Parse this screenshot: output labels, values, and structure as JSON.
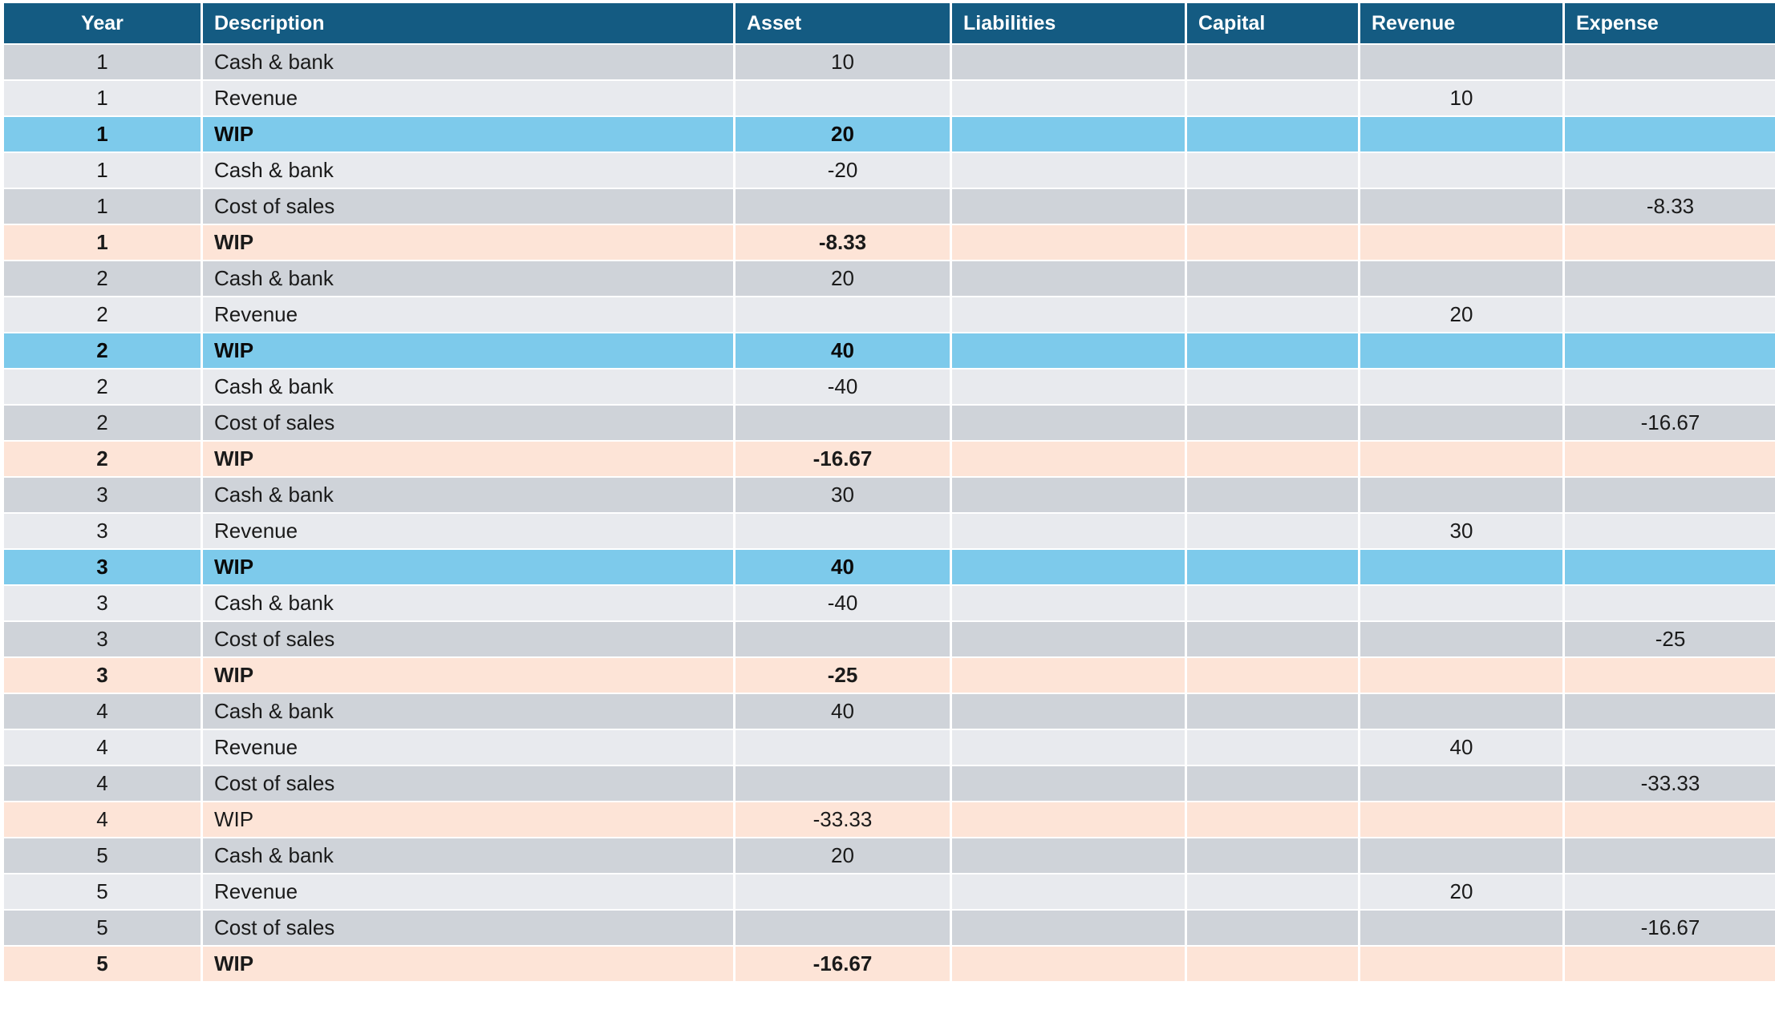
{
  "headers": {
    "year": "Year",
    "description": "Description",
    "asset": "Asset",
    "liabilities": "Liabilities",
    "capital": "Capital",
    "revenue": "Revenue",
    "expense": "Expense"
  },
  "colors": {
    "header": "#145b82",
    "row_dark": "#cfd3d9",
    "row_light": "#e8eaee",
    "row_highlight_blue": "#7dcaeb",
    "row_highlight_peach": "#fde4d7"
  },
  "rows": [
    {
      "style": "row-a",
      "bold": false,
      "year": "1",
      "description": "Cash & bank",
      "asset": "10",
      "liabilities": "",
      "capital": "",
      "revenue": "",
      "expense": ""
    },
    {
      "style": "row-b",
      "bold": false,
      "year": "1",
      "description": "Revenue",
      "asset": "",
      "liabilities": "",
      "capital": "",
      "revenue": "10",
      "expense": ""
    },
    {
      "style": "row-blue",
      "bold": true,
      "year": "1",
      "description": "WIP",
      "asset": "20",
      "liabilities": "",
      "capital": "",
      "revenue": "",
      "expense": ""
    },
    {
      "style": "row-b",
      "bold": false,
      "year": "1",
      "description": "Cash & bank",
      "asset": "-20",
      "liabilities": "",
      "capital": "",
      "revenue": "",
      "expense": ""
    },
    {
      "style": "row-a",
      "bold": false,
      "year": "1",
      "description": "Cost of sales",
      "asset": "",
      "liabilities": "",
      "capital": "",
      "revenue": "",
      "expense": "-8.33"
    },
    {
      "style": "row-peach",
      "bold": true,
      "year": "1",
      "description": "WIP",
      "asset": "-8.33",
      "liabilities": "",
      "capital": "",
      "revenue": "",
      "expense": ""
    },
    {
      "style": "row-a",
      "bold": false,
      "year": "2",
      "description": "Cash & bank",
      "asset": "20",
      "liabilities": "",
      "capital": "",
      "revenue": "",
      "expense": ""
    },
    {
      "style": "row-b",
      "bold": false,
      "year": "2",
      "description": "Revenue",
      "asset": "",
      "liabilities": "",
      "capital": "",
      "revenue": "20",
      "expense": ""
    },
    {
      "style": "row-blue",
      "bold": true,
      "year": "2",
      "description": "WIP",
      "asset": "40",
      "liabilities": "",
      "capital": "",
      "revenue": "",
      "expense": ""
    },
    {
      "style": "row-b",
      "bold": false,
      "year": "2",
      "description": "Cash & bank",
      "asset": "-40",
      "liabilities": "",
      "capital": "",
      "revenue": "",
      "expense": ""
    },
    {
      "style": "row-a",
      "bold": false,
      "year": "2",
      "description": "Cost of sales",
      "asset": "",
      "liabilities": "",
      "capital": "",
      "revenue": "",
      "expense": "-16.67"
    },
    {
      "style": "row-peach",
      "bold": true,
      "year": "2",
      "description": "WIP",
      "asset": "-16.67",
      "liabilities": "",
      "capital": "",
      "revenue": "",
      "expense": ""
    },
    {
      "style": "row-a",
      "bold": false,
      "year": "3",
      "description": "Cash & bank",
      "asset": "30",
      "liabilities": "",
      "capital": "",
      "revenue": "",
      "expense": ""
    },
    {
      "style": "row-b",
      "bold": false,
      "year": "3",
      "description": "Revenue",
      "asset": "",
      "liabilities": "",
      "capital": "",
      "revenue": "30",
      "expense": ""
    },
    {
      "style": "row-blue",
      "bold": true,
      "year": "3",
      "description": "WIP",
      "asset": "40",
      "liabilities": "",
      "capital": "",
      "revenue": "",
      "expense": ""
    },
    {
      "style": "row-b",
      "bold": false,
      "year": "3",
      "description": "Cash & bank",
      "asset": "-40",
      "liabilities": "",
      "capital": "",
      "revenue": "",
      "expense": ""
    },
    {
      "style": "row-a",
      "bold": false,
      "year": "3",
      "description": "Cost of sales",
      "asset": "",
      "liabilities": "",
      "capital": "",
      "revenue": "",
      "expense": "-25"
    },
    {
      "style": "row-peach",
      "bold": true,
      "year": "3",
      "description": "WIP",
      "asset": "-25",
      "liabilities": "",
      "capital": "",
      "revenue": "",
      "expense": ""
    },
    {
      "style": "row-a",
      "bold": false,
      "year": "4",
      "description": "Cash & bank",
      "asset": "40",
      "liabilities": "",
      "capital": "",
      "revenue": "",
      "expense": ""
    },
    {
      "style": "row-b",
      "bold": false,
      "year": "4",
      "description": "Revenue",
      "asset": "",
      "liabilities": "",
      "capital": "",
      "revenue": "40",
      "expense": ""
    },
    {
      "style": "row-a",
      "bold": false,
      "year": "4",
      "description": "Cost of sales",
      "asset": "",
      "liabilities": "",
      "capital": "",
      "revenue": "",
      "expense": "-33.33"
    },
    {
      "style": "row-peach",
      "bold": false,
      "year": "4",
      "description": "WIP",
      "asset": "-33.33",
      "liabilities": "",
      "capital": "",
      "revenue": "",
      "expense": ""
    },
    {
      "style": "row-a",
      "bold": false,
      "year": "5",
      "description": "Cash & bank",
      "asset": "20",
      "liabilities": "",
      "capital": "",
      "revenue": "",
      "expense": ""
    },
    {
      "style": "row-b",
      "bold": false,
      "year": "5",
      "description": "Revenue",
      "asset": "",
      "liabilities": "",
      "capital": "",
      "revenue": "20",
      "expense": ""
    },
    {
      "style": "row-a",
      "bold": false,
      "year": "5",
      "description": "Cost of sales",
      "asset": "",
      "liabilities": "",
      "capital": "",
      "revenue": "",
      "expense": "-16.67"
    },
    {
      "style": "row-peach",
      "bold": true,
      "year": "5",
      "description": "WIP",
      "asset": "-16.67",
      "liabilities": "",
      "capital": "",
      "revenue": "",
      "expense": ""
    }
  ]
}
